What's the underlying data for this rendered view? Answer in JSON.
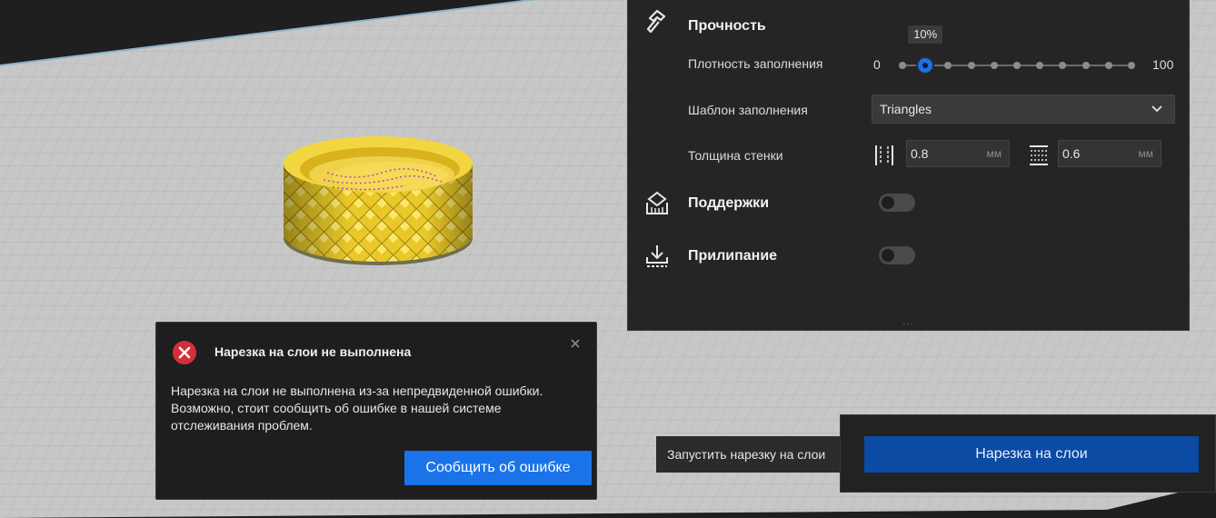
{
  "settings": {
    "strength": {
      "title": "Прочность"
    },
    "infill_density": {
      "label": "Плотность заполнения",
      "min_label": "0",
      "max_label": "100",
      "value": 10,
      "value_label": "10%"
    },
    "infill_pattern": {
      "label": "Шаблон заполнения",
      "selected": "Triangles"
    },
    "wall_thickness": {
      "label": "Толщина стенки",
      "wall_value": "0.8",
      "top_bottom_value": "0.6",
      "unit": "мм"
    },
    "supports": {
      "title": "Поддержки",
      "enabled": false
    },
    "adhesion": {
      "title": "Прилипание",
      "enabled": false
    }
  },
  "error_message": {
    "title": "Нарезка на слои не выполнена",
    "body_lines": [
      "Нарезка на слои не выполнена из-за непредвиденной ошибки.",
      "Возможно, стоит сообщить об ошибке в нашей системе",
      "отслеживания проблем."
    ],
    "report_button": "Сообщить об ошибке"
  },
  "slice": {
    "tooltip": "Запустить нарезку на слои",
    "button": "Нарезка на слои"
  },
  "colors": {
    "accent": "#1a73e8",
    "slice_button": "#0b4ba3",
    "error_red": "#d32f3a",
    "model_yellow": "#f5d431",
    "build_plate": "#c8c8c8"
  },
  "icons": {
    "strength": "hammer-icon",
    "supports": "support-structure-icon",
    "adhesion": "adhesion-icon",
    "wall": "wall-thickness-icon",
    "top_bottom": "top-bottom-thickness-icon",
    "error": "error-x-circle-icon",
    "close": "close-icon",
    "dropdown": "chevron-down-icon"
  }
}
